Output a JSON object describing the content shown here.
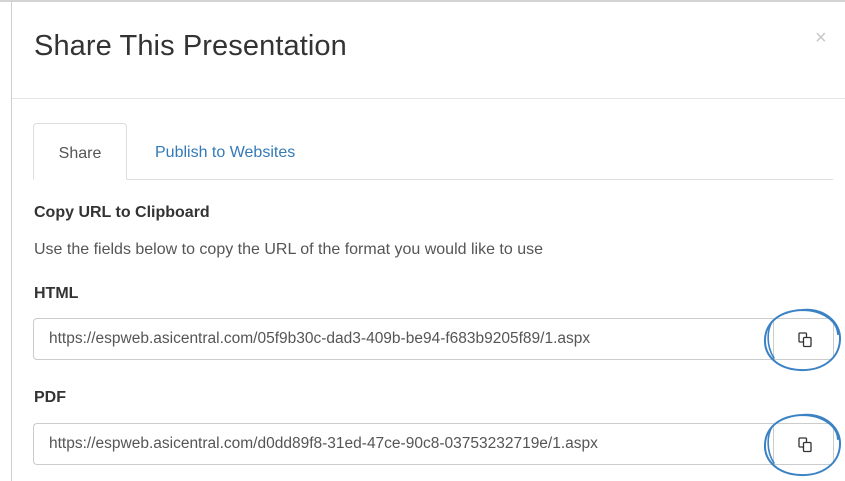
{
  "modal": {
    "title": "Share This Presentation",
    "close_label": "×"
  },
  "tabs": [
    {
      "label": "Share",
      "active": true
    },
    {
      "label": "Publish to Websites",
      "active": false
    }
  ],
  "share": {
    "section_title": "Copy URL to Clipboard",
    "help_text": "Use the fields below to copy the URL of the format you would like to use",
    "fields": [
      {
        "label": "HTML",
        "value": "https://espweb.asicentral.com/05f9b30c-dad3-409b-be94-f683b9205f89/1.aspx",
        "button_icon": "copy-icon"
      },
      {
        "label": "PDF",
        "value": "https://espweb.asicentral.com/d0dd89f8-31ed-47ce-90c8-03753232719e/1.aspx",
        "button_icon": "copy-icon"
      }
    ]
  },
  "colors": {
    "link": "#337ab7",
    "annotation_circle": "#3b82c4"
  }
}
